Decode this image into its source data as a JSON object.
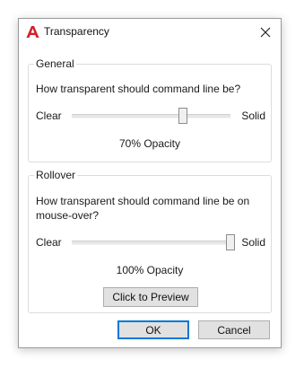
{
  "window": {
    "title": "Transparency",
    "app_icon": "autocad-a-icon",
    "close_icon": "close-icon",
    "brand_color": "#d2232a"
  },
  "general": {
    "legend": "General",
    "question": "How transparent should command line be?",
    "clear_label": "Clear",
    "solid_label": "Solid",
    "slider_value_percent": 70,
    "opacity_text": "70% Opacity"
  },
  "rollover": {
    "legend": "Rollover",
    "question": "How transparent should command line be on mouse-over?",
    "clear_label": "Clear",
    "solid_label": "Solid",
    "slider_value_percent": 100,
    "opacity_text": "100% Opacity",
    "preview_label": "Click to Preview"
  },
  "buttons": {
    "ok_label": "OK",
    "cancel_label": "Cancel"
  }
}
